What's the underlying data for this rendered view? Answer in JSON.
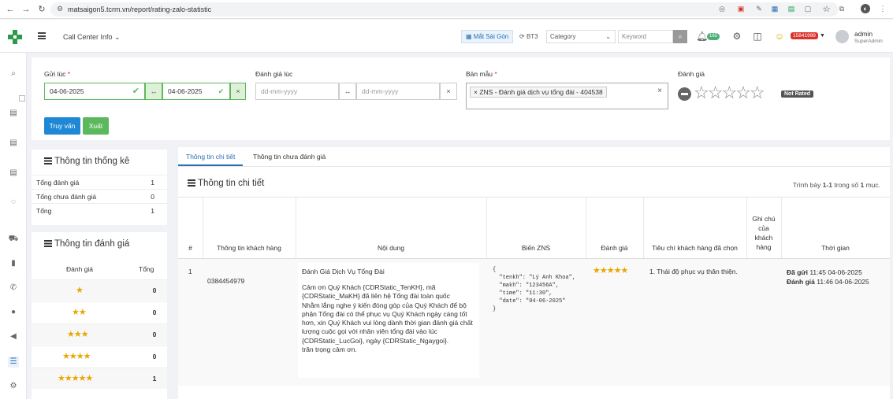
{
  "browser": {
    "url": "matsaigon5.tcrm.vn/report/rating-zalo-statistic"
  },
  "header": {
    "menu_label": "Call Center Info",
    "site_label": "Mắt Sài Gòn",
    "bt3_label": "BT3",
    "category_label": "Category",
    "keyword_placeholder": "Keyword",
    "notif_count": "165",
    "red_badge": "15841999",
    "user_name": "admin",
    "user_role": "SuperAdmin"
  },
  "filter": {
    "sent_label": "Gửi lúc",
    "sent_from": "04-06-2025",
    "sent_to": "04-06-2025",
    "rated_label": "Đánh giá lúc",
    "rated_from_placeholder": "dd-mm-yyyy",
    "rated_to_placeholder": "dd-mm-yyyy",
    "template_label": "Bản mẫu",
    "template_value": "ZNS - Đánh giá dịch vụ tổng đài - 404538",
    "rating_label": "Đánh giá",
    "rating_status": "Not Rated",
    "query_button": "Truy vấn",
    "export_button": "Xuất"
  },
  "stats": {
    "title": "Thông tin thống kê",
    "rows": [
      {
        "label": "Tổng đánh giá",
        "value": "1"
      },
      {
        "label": "Tổng chưa đánh giá",
        "value": "0"
      },
      {
        "label": "Tổng",
        "value": "1"
      }
    ]
  },
  "ratings": {
    "title": "Thông tin đánh giá",
    "col_rating": "Đánh giá",
    "col_total": "Tổng",
    "rows": [
      {
        "stars": "★",
        "count": "0"
      },
      {
        "stars": "★★",
        "count": "0"
      },
      {
        "stars": "★★★",
        "count": "0"
      },
      {
        "stars": "★★★★",
        "count": "0"
      },
      {
        "stars": "★★★★★",
        "count": "1"
      }
    ]
  },
  "detail": {
    "tabs": [
      "Thông tin chi tiết",
      "Thông tin chưa đánh giá"
    ],
    "title": "Thông tin chi tiết",
    "summary_pre": "Trình bày",
    "summary_range": "1-1",
    "summary_mid": "trong số",
    "summary_total": "1",
    "summary_post": "mục.",
    "columns": {
      "num": "#",
      "customer": "Thông tin khách hàng",
      "content": "Nội dung",
      "zns_vars": "Biến ZNS",
      "rating": "Đánh giá",
      "criteria": "Tiêu chí khách hàng đã chọn",
      "note": "Ghi chú của khách hàng",
      "time": "Thời gian"
    },
    "row": {
      "num": "1",
      "phone": "0384454979",
      "content_title": "Đánh Giá Dịch Vụ Tổng Đài",
      "content_body": "Cảm ơn Quý Khách {CDRStatic_TenKH}, mã {CDRStatic_MaKH} đã liên hệ Tổng đài toàn quốc\nNhằm lắng nghe ý kiến đóng góp của Quý Khách để bộ phận Tổng đài có thể phục vụ Quý Khách ngày càng tốt hơn, xin Quý Khách vui lòng dành thời gian đánh giá chất lượng cuộc gọi với nhân viên tổng đài vào lúc {CDRStatic_LucGoi}, ngày {CDRStatic_Ngaygoi}.\ntrân trọng cảm ơn.",
      "zns_json": "{\n  \"tenkh\": \"Lý Anh Khoa\",\n  \"makh\": \"123456A\",\n  \"time\": \"11:30\",\n  \"date\": \"04-06-2025\"\n}",
      "stars": "★★★★★",
      "criteria": "1. Thái độ phục vụ thân thiện.",
      "sent_label": "Đã gửi",
      "sent_time": "11:45 04-06-2025",
      "rated_label": "Đánh giá",
      "rated_time": "11:46 04-06-2025"
    }
  },
  "colors": {
    "primary": "#2a6fb5",
    "query_button": "#1e88d6",
    "export_button": "#5cb85c",
    "star": "#e6a700",
    "danger_badge": "#d9342b"
  }
}
